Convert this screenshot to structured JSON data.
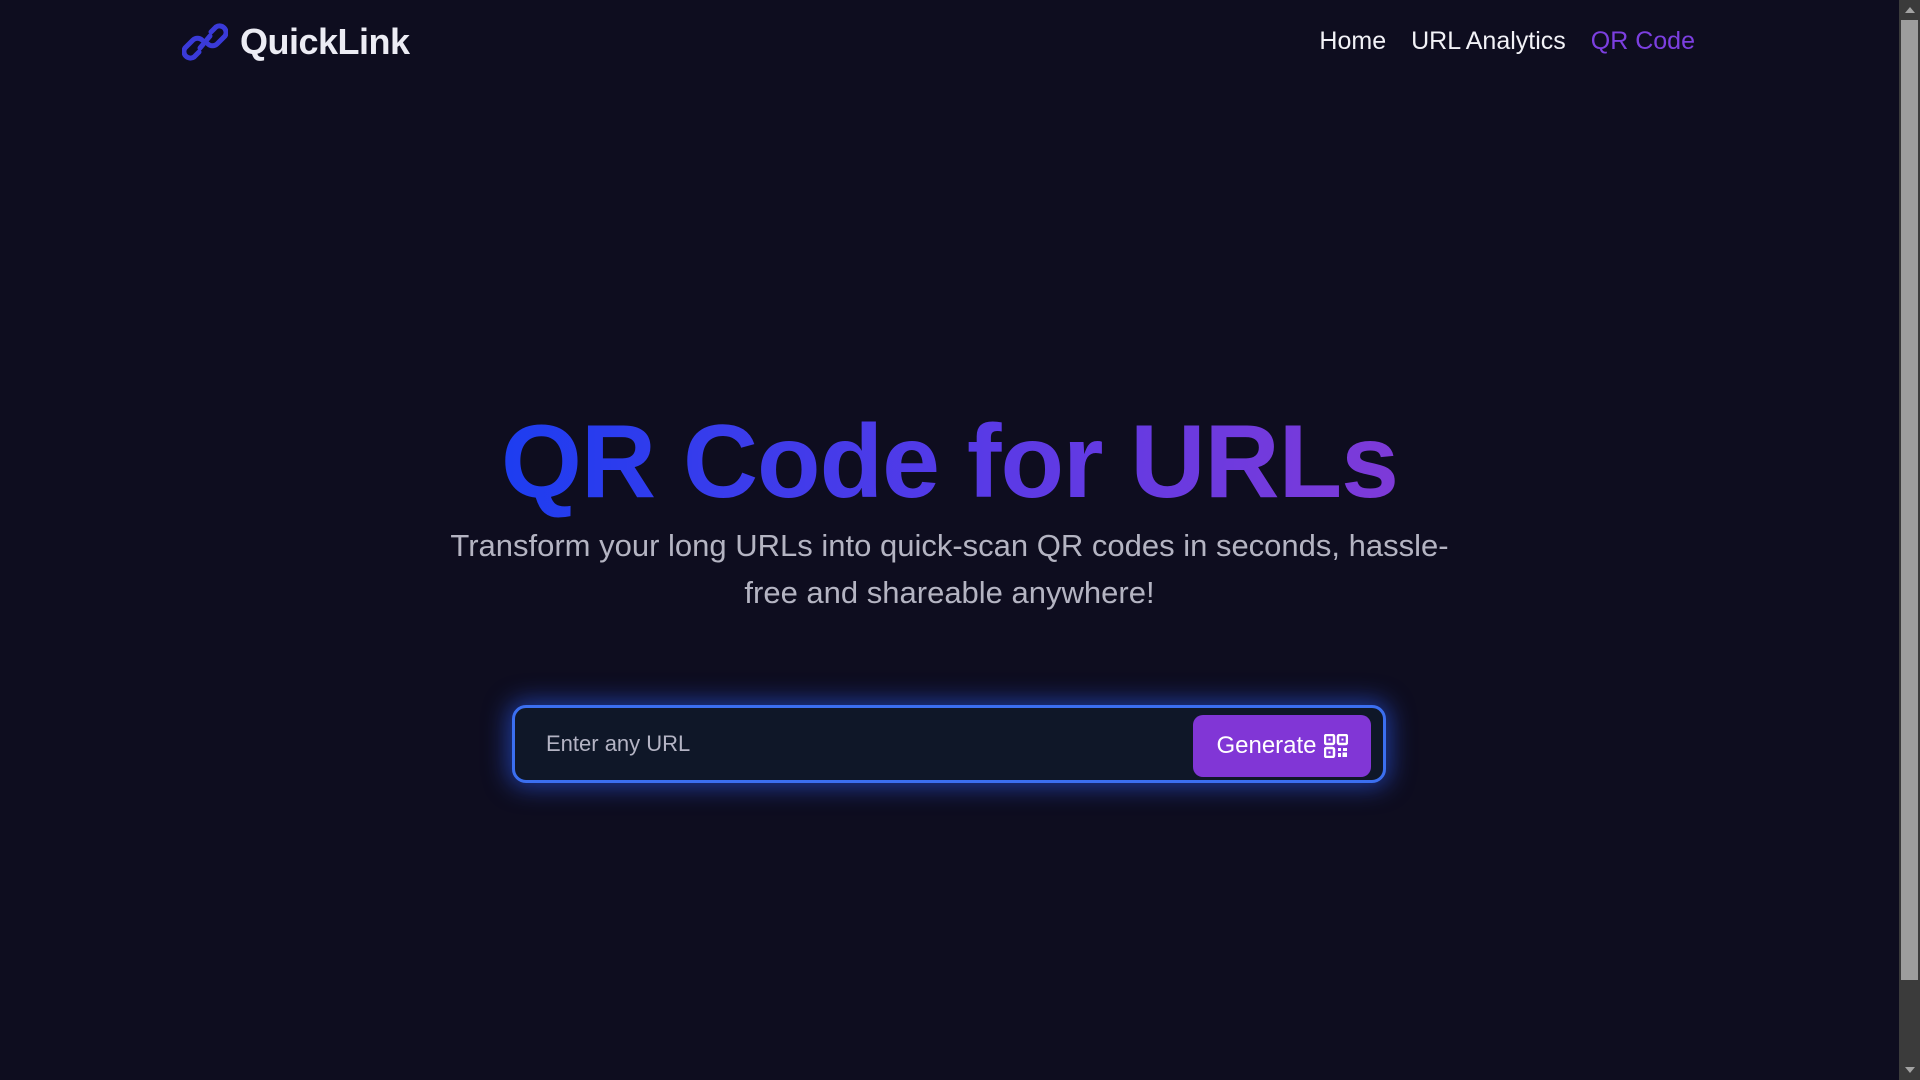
{
  "brand": {
    "name": "QuickLink",
    "icon": "link-icon",
    "accent": "#3b3bd8"
  },
  "nav": {
    "items": [
      {
        "label": "Home",
        "active": false
      },
      {
        "label": "URL Analytics",
        "active": false
      },
      {
        "label": "QR Code",
        "active": true
      }
    ],
    "active_color": "#7c3fe0"
  },
  "hero": {
    "title": "QR Code for URLs",
    "subtitle": "Transform your long URLs into quick-scan QR codes in seconds, hassle-free and shareable anywhere!"
  },
  "search": {
    "placeholder": "Enter any URL",
    "value": "",
    "button_label": "Generate",
    "button_icon": "qr-code-icon",
    "button_color": "#8136d6",
    "border_color": "#3b6ff0"
  },
  "colors": {
    "background": "#0e0d1f",
    "title_gradient_start": "#1d3df0",
    "title_gradient_end": "#7e3ad8"
  }
}
